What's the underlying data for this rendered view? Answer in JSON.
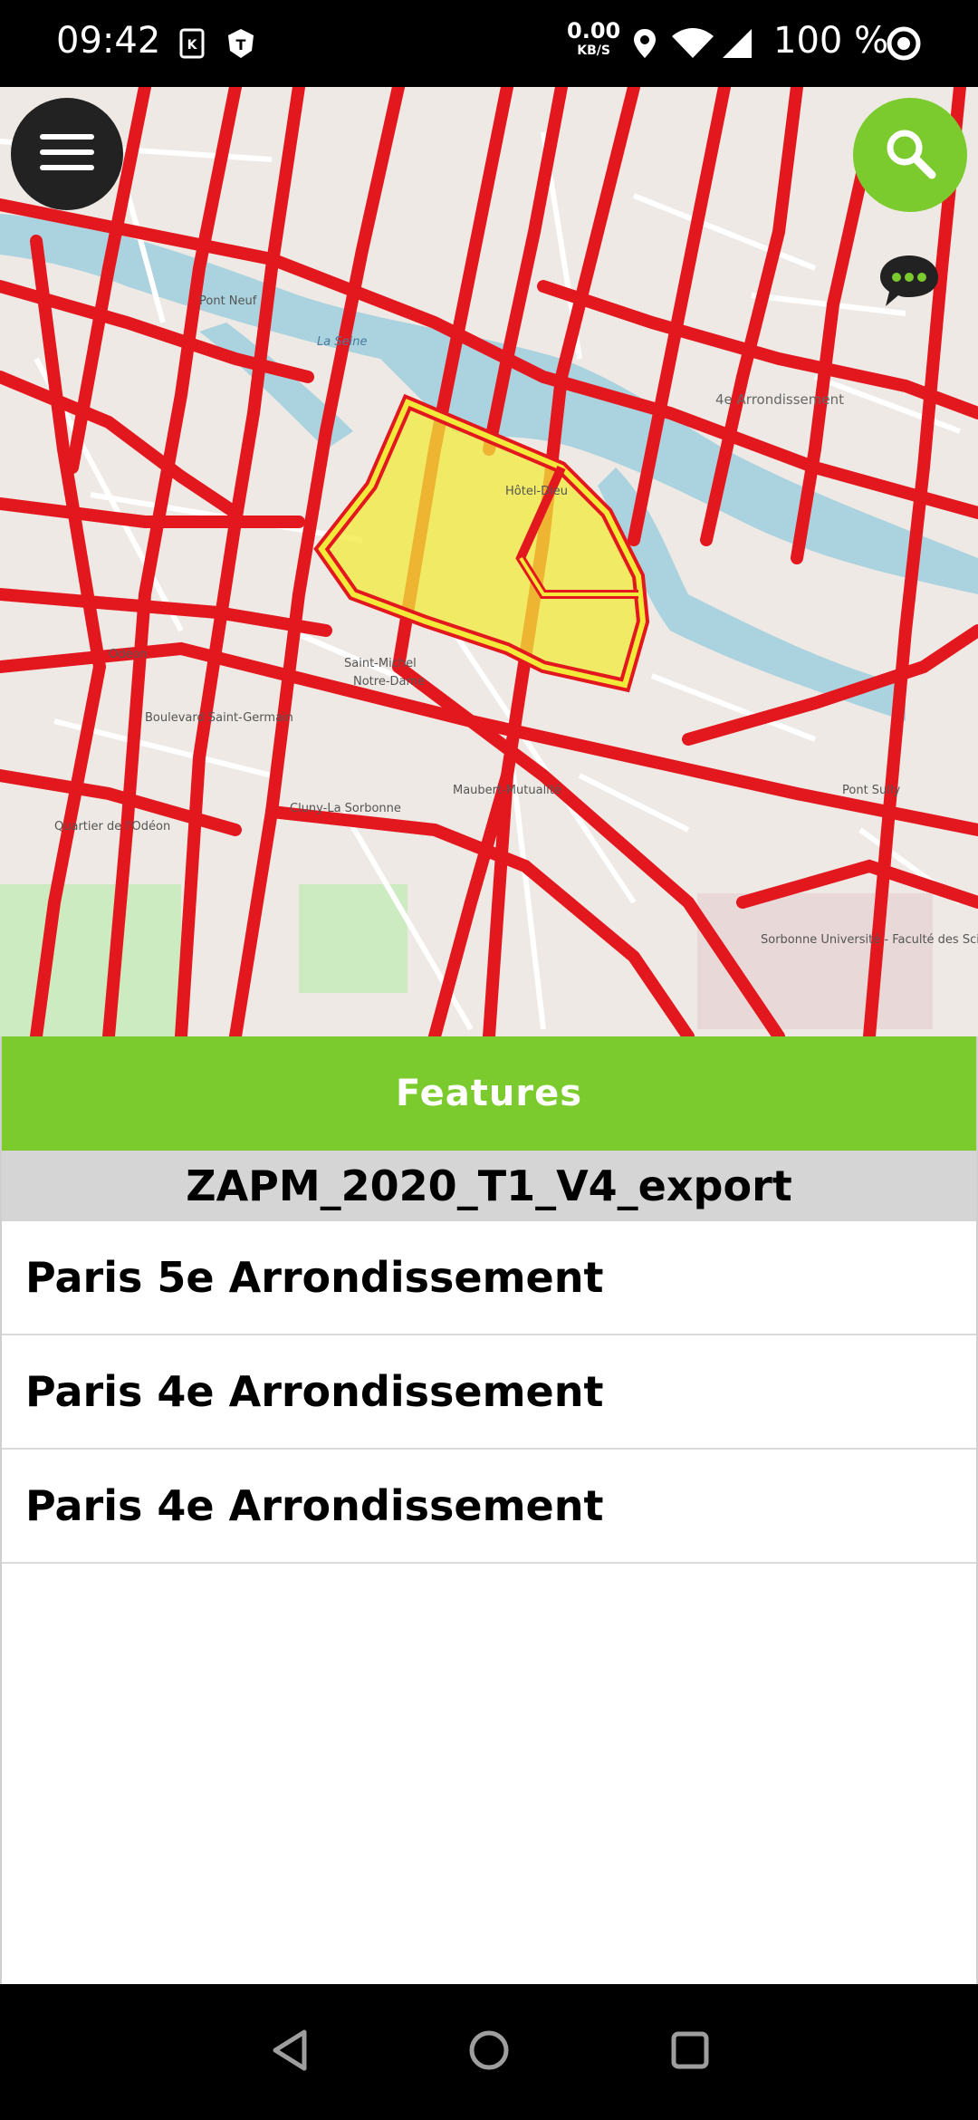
{
  "status_bar": {
    "time": "09:42",
    "net_speed_value": "0.00",
    "net_speed_unit": "KB/S",
    "battery": "100 %",
    "icons": [
      "sim-card-icon",
      "shield-t-icon",
      "location-icon",
      "wifi-icon",
      "signal-icon",
      "target-icon"
    ]
  },
  "map": {
    "labels": {
      "saint_michel": "Saint-Michel",
      "notre_dame": "Notre-Dame",
      "hotel_dieu": "Hôtel-Dieu",
      "arr_4e": "4e Arrondissement",
      "quartier_odeon": "Quartier de l'Odéon",
      "cluny": "Cluny-La Sorbonne",
      "maubert": "Maubert-Mutualité",
      "sorbonne": "Sorbonne Université - Faculté des Sciences et Ingénierie",
      "pont_neuf": "Pont Neuf",
      "la_seine": "La Seine",
      "pont_sully": "Pont Sully",
      "odeon": "Odéon",
      "bd_saint_germain": "Boulevard Saint-Germain"
    },
    "highlight_color": "#f2ea3a",
    "road_color": "#e3181f",
    "water_color": "#aad3df"
  },
  "buttons": {
    "menu": "menu-icon",
    "search": "search-icon",
    "chat": "chat-icon"
  },
  "panel": {
    "header": "Features",
    "layer_title": "ZAPM_2020_T1_V4_export",
    "features": [
      "Paris 5e Arrondissement",
      "Paris 4e Arrondissement",
      "Paris 4e Arrondissement"
    ]
  },
  "navbar": {
    "back": "back-icon",
    "home": "home-icon",
    "recents": "recents-icon"
  }
}
